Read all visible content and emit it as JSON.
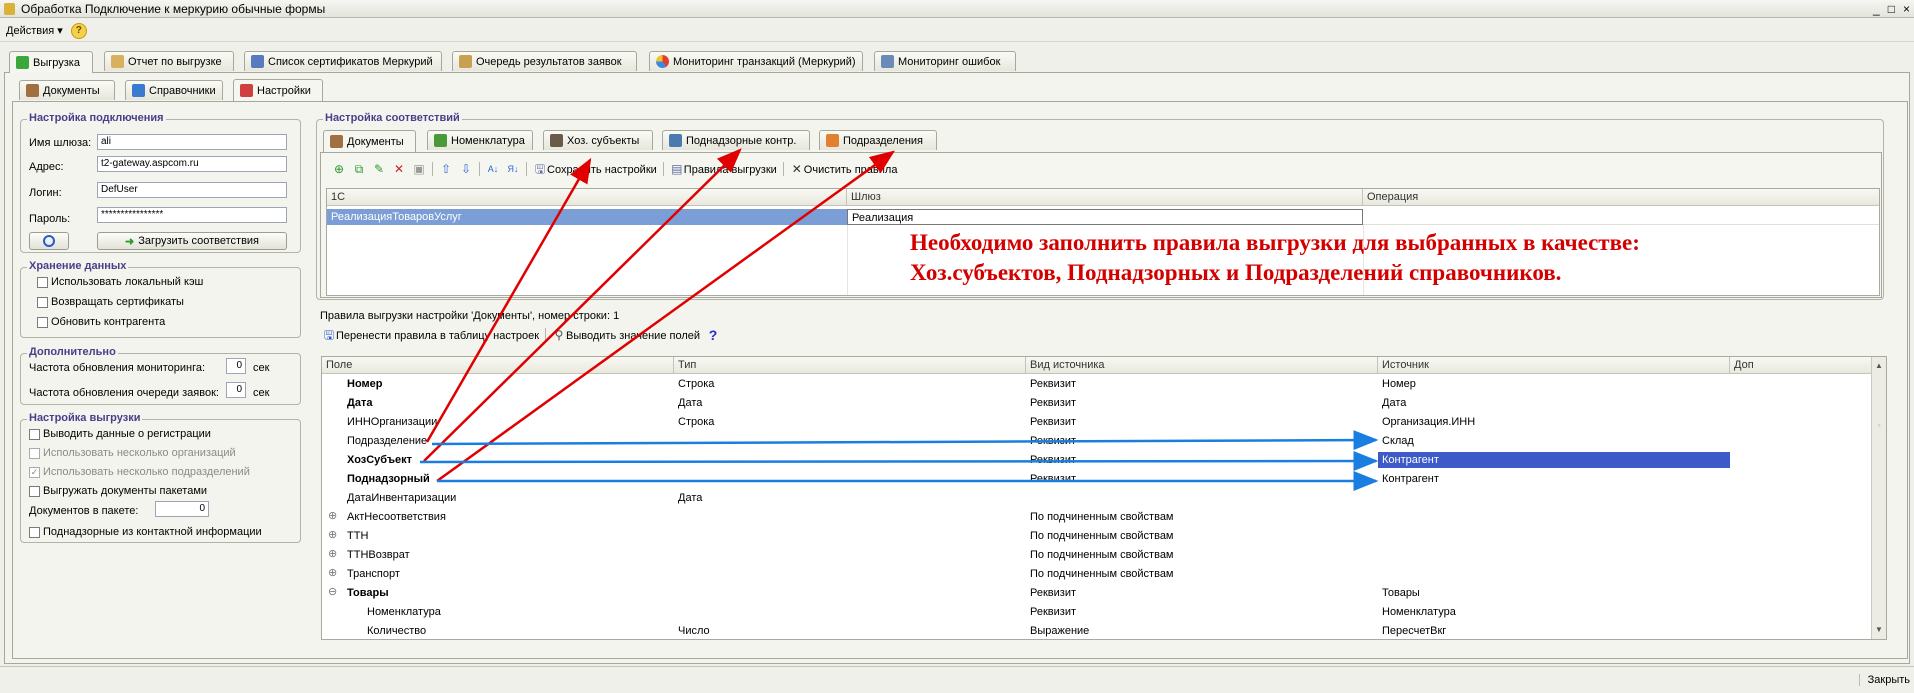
{
  "window": {
    "title": "Обработка  Подключение к меркурию обычные формы",
    "controls": [
      "_",
      "□",
      "×"
    ]
  },
  "menu": {
    "actions": "Действия",
    "help_icon": "?"
  },
  "main_tabs": [
    {
      "label": "Выгрузка"
    },
    {
      "label": "Отчет по выгрузке"
    },
    {
      "label": "Список сертификатов Меркурий"
    },
    {
      "label": "Очередь результатов заявок"
    },
    {
      "label": "Мониторинг транзакций (Меркурий)"
    },
    {
      "label": "Мониторинг ошибок"
    }
  ],
  "sub_tabs": [
    {
      "label": "Документы"
    },
    {
      "label": "Справочники"
    },
    {
      "label": "Настройки"
    }
  ],
  "connection": {
    "title": "Настройка подключения",
    "gateway_label": "Имя шлюза:",
    "gateway_value": "ali",
    "address_label": "Адрес:",
    "address_value": "t2-gateway.aspcom.ru",
    "login_label": "Логин:",
    "login_value": "DefUser",
    "password_label": "Пароль:",
    "password_value": "****************",
    "load_button": "Загрузить соответствия"
  },
  "storage": {
    "title": "Хранение данных",
    "options": [
      "Использовать локальный кэш",
      "Возвращать сертификаты",
      "Обновить контрагента"
    ]
  },
  "extra": {
    "title": "Дополнительно",
    "monitor_label": "Частота обновления мониторинга:",
    "monitor_value": "0",
    "monitor_unit": "сек",
    "queue_label": "Частота обновления очереди заявок:",
    "queue_value": "0",
    "queue_unit": "сек"
  },
  "upload": {
    "title": "Настройка выгрузки",
    "options": [
      {
        "label": "Выводить данные о регистрации",
        "checked": false,
        "disabled": false
      },
      {
        "label": "Использовать несколько организаций",
        "checked": false,
        "disabled": true
      },
      {
        "label": "Использовать несколько подразделений",
        "checked": true,
        "disabled": true
      },
      {
        "label": "Выгружать документы пакетами",
        "checked": false,
        "disabled": false
      }
    ],
    "batch_label": "Документов в пакете:",
    "batch_value": "0",
    "contact_option": "Поднадзорные из контактной информации"
  },
  "mapping": {
    "title": "Настройка соответствий",
    "tabs": [
      {
        "label": "Документы"
      },
      {
        "label": "Номенклатура"
      },
      {
        "label": "Хоз. субъекты"
      },
      {
        "label": "Поднадзорные контр."
      },
      {
        "label": "Подразделения"
      }
    ],
    "toolbar": {
      "save": "Сохранить настройки",
      "rules": "Правила выгрузки",
      "clear": "Очистить правила"
    },
    "columns": [
      "1С",
      "Шлюз",
      "Операция"
    ],
    "rows": [
      {
        "c1": "РеализацияТоваровУслуг",
        "c2": "Реализация",
        "c3": ""
      }
    ]
  },
  "note": {
    "line1": "Необходимо заполнить правила выгрузки для выбранных в качестве:",
    "line2": "Хоз.субъектов, Поднадзорных и Подразделений справочников."
  },
  "rules": {
    "caption": "Правила выгрузки настройки 'Документы', номер строки: 1",
    "transfer_button": "Перенести правила в таблицу настроек",
    "show_button": "Выводить значение полей",
    "columns": [
      "Поле",
      "Тип",
      "Вид источника",
      "Источник",
      "Доп"
    ],
    "rows": [
      {
        "field": "Номер",
        "type": "Строка",
        "kind": "Реквизит",
        "source": "Номер",
        "bold": true,
        "expander": "",
        "indent": 0
      },
      {
        "field": "Дата",
        "type": "Дата",
        "kind": "Реквизит",
        "source": "Дата",
        "bold": true,
        "expander": "",
        "indent": 0
      },
      {
        "field": "ИННОрганизации",
        "type": "Строка",
        "kind": "Реквизит",
        "source": "Организация.ИНН",
        "bold": false,
        "expander": "",
        "indent": 0
      },
      {
        "field": "Подразделение",
        "type": "",
        "kind": "Реквизит",
        "source": "Склад",
        "bold": false,
        "expander": "",
        "indent": 0
      },
      {
        "field": "ХозСубъект",
        "type": "",
        "kind": "Реквизит",
        "source": "Контрагент",
        "bold": true,
        "expander": "",
        "indent": 0,
        "selected": true
      },
      {
        "field": "Поднадзорный",
        "type": "",
        "kind": "Реквизит",
        "source": "Контрагент",
        "bold": true,
        "expander": "",
        "indent": 0
      },
      {
        "field": "ДатаИнвентаризации",
        "type": "Дата",
        "kind": "",
        "source": "",
        "bold": false,
        "expander": "",
        "indent": 0
      },
      {
        "field": "АктНесоответствия",
        "type": "",
        "kind": "По подчиненным свойствам",
        "source": "",
        "bold": false,
        "expander": "⊕",
        "indent": 0
      },
      {
        "field": "ТТН",
        "type": "",
        "kind": "По подчиненным свойствам",
        "source": "",
        "bold": false,
        "expander": "⊕",
        "indent": 0
      },
      {
        "field": "ТТНВозврат",
        "type": "",
        "kind": "По подчиненным свойствам",
        "source": "",
        "bold": false,
        "expander": "⊕",
        "indent": 0
      },
      {
        "field": "Транспорт",
        "type": "",
        "kind": "По подчиненным свойствам",
        "source": "",
        "bold": false,
        "expander": "⊕",
        "indent": 0
      },
      {
        "field": "Товары",
        "type": "",
        "kind": "Реквизит",
        "source": "Товары",
        "bold": true,
        "expander": "⊖",
        "indent": 0
      },
      {
        "field": "Номенклатура",
        "type": "",
        "kind": "Реквизит",
        "source": "Номенклатура",
        "bold": false,
        "expander": "",
        "indent": 1
      },
      {
        "field": "Количество",
        "type": "Число",
        "kind": "Выражение",
        "source": "ПересчетВкг",
        "bold": false,
        "expander": "",
        "indent": 1
      }
    ]
  },
  "status": {
    "close": "Закрыть"
  },
  "colors": {
    "selection": "#3d5ac8",
    "row_selected_1c": "#7b9ed6",
    "annotation_red": "#e00000",
    "annotation_blue": "#1a7ee0"
  }
}
